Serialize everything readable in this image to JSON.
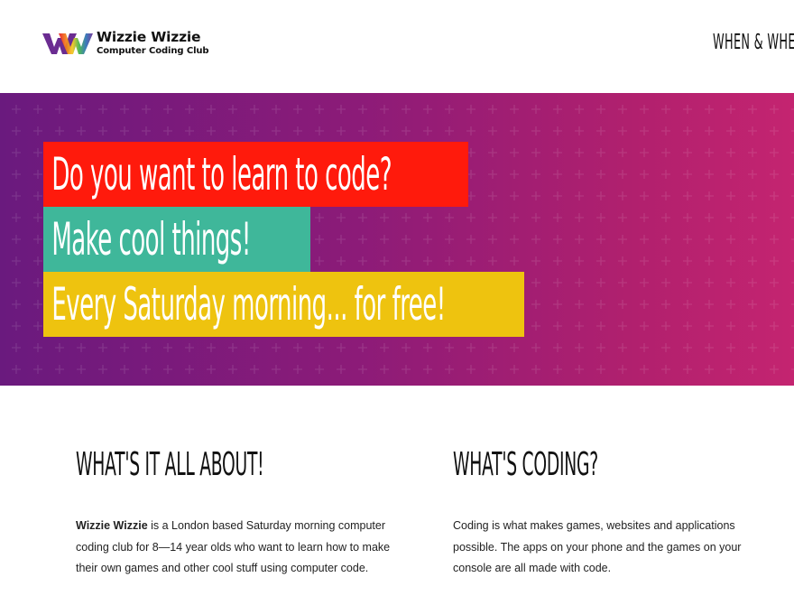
{
  "header": {
    "logo": {
      "title": "Wizzie Wizzie",
      "subtitle": "Computer Coding Club",
      "mark_colors": [
        "#e8141e",
        "#f07a1a",
        "#f6c51b",
        "#3fb34a",
        "#2c6fb7",
        "#6b2c91"
      ]
    },
    "nav": {
      "when_where": "When & Wher"
    }
  },
  "hero": {
    "gradient": [
      "#6a1a7e",
      "#c42470"
    ],
    "bars": [
      {
        "text": "Do you want to learn to code?",
        "color": "#ff1a0c"
      },
      {
        "text": "Make cool things!",
        "color": "#3fb79a"
      },
      {
        "text": "Every Saturday morning... for free!",
        "color": "#eec30f"
      }
    ]
  },
  "content": {
    "about": {
      "heading": "What's it all about!",
      "lead_bold": "Wizzie Wizzie",
      "body": " is a London based Saturday morning computer coding club for 8—14 year olds who want to learn how to make their own games and other cool stuff using computer code."
    },
    "coding": {
      "heading": "What's coding?",
      "body": "Coding is what makes games, websites and applications possible. The apps on your phone and the games on your console are all made with code."
    }
  }
}
